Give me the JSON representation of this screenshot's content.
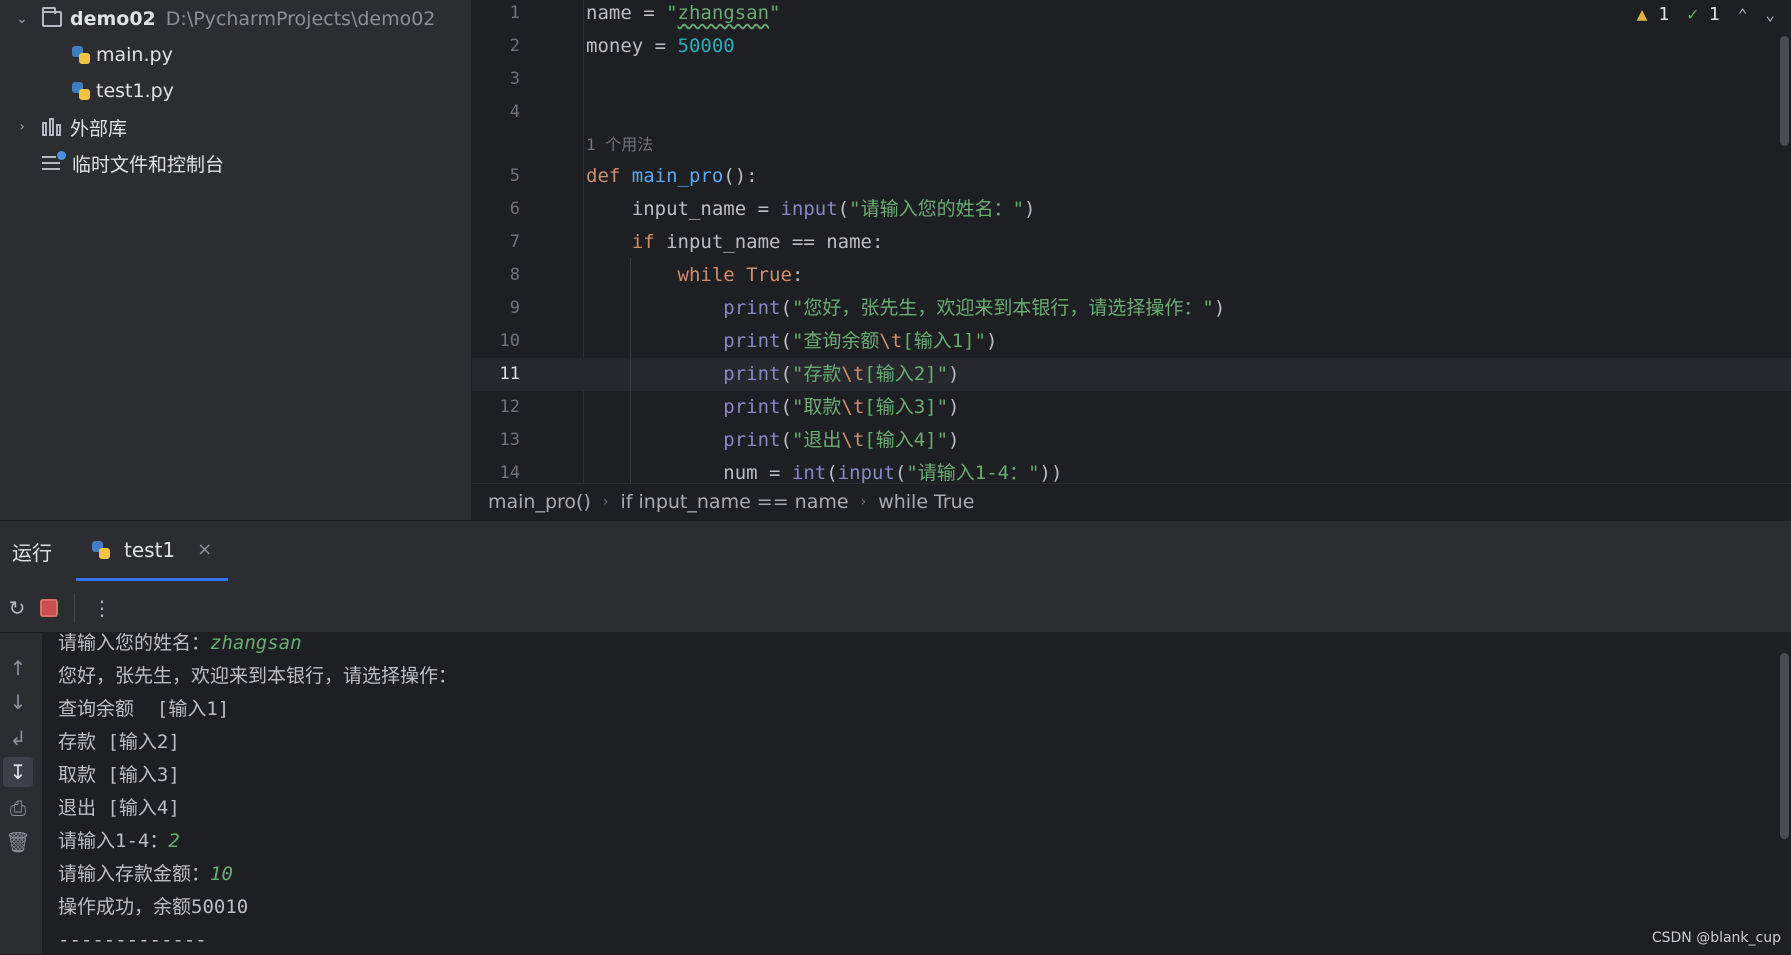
{
  "project_tree": {
    "root_name": "demo02",
    "root_path": "D:\\PycharmProjects\\demo02",
    "files": [
      "main.py",
      "test1.py"
    ],
    "external_libs": "外部库",
    "scratches": "临时文件和控制台"
  },
  "editor": {
    "usage_hint": "1 个用法",
    "line_numbers": [
      "1",
      "2",
      "3",
      "4",
      "5",
      "6",
      "7",
      "8",
      "9",
      "10",
      "11",
      "12",
      "13",
      "14"
    ],
    "current_line": "11",
    "inspections": {
      "warnings": "1",
      "ok": "1"
    }
  },
  "breadcrumb": [
    "main_pro()",
    "if input_name == name",
    "while True"
  ],
  "run": {
    "title": "运行",
    "tab_label": "test1",
    "console_lines": [
      {
        "text": "请输入您的姓名：",
        "input": "zhangsan"
      },
      {
        "text": "您好，张先生，欢迎来到本银行，请选择操作：",
        "input": ""
      },
      {
        "text": "查询余额  [输入1]",
        "input": ""
      },
      {
        "text": "存款 [输入2]",
        "input": ""
      },
      {
        "text": "取款 [输入3]",
        "input": ""
      },
      {
        "text": "退出 [输入4]",
        "input": ""
      },
      {
        "text": "请输入1-4：",
        "input": "2"
      },
      {
        "text": "请输入存款金额：",
        "input": "10"
      },
      {
        "text": "操作成功，余额50010",
        "input": ""
      },
      {
        "text": "-------------",
        "input": ""
      }
    ]
  },
  "watermark": "CSDN @blank_cup",
  "colors": {
    "bg_editor": "#1e1f22",
    "bg_panel": "#2b2d30",
    "keyword": "#cf8e6d",
    "string": "#6aab73",
    "number": "#2aacb8",
    "builtin": "#8888c6",
    "function": "#56a8f5",
    "accent": "#3574f0"
  }
}
